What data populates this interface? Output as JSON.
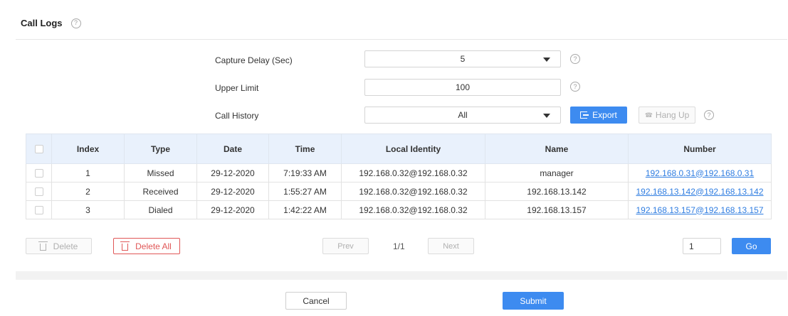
{
  "header": {
    "title": "Call Logs",
    "help_glyph": "?"
  },
  "form": {
    "capture_delay": {
      "label": "Capture Delay (Sec)",
      "value": "5"
    },
    "upper_limit": {
      "label": "Upper Limit",
      "value": "100"
    },
    "call_history": {
      "label": "Call History",
      "value": "All"
    }
  },
  "actions": {
    "export_label": "Export",
    "hangup_label": "Hang Up",
    "hangup_icon": "phone-icon"
  },
  "table": {
    "columns": [
      "Index",
      "Type",
      "Date",
      "Time",
      "Local Identity",
      "Name",
      "Number"
    ],
    "rows": [
      {
        "index": "1",
        "type": "Missed",
        "date": "29-12-2020",
        "time": "7:19:33 AM",
        "local_identity": "192.168.0.32@192.168.0.32",
        "name": "manager",
        "number": "192.168.0.31@192.168.0.31"
      },
      {
        "index": "2",
        "type": "Received",
        "date": "29-12-2020",
        "time": "1:55:27 AM",
        "local_identity": "192.168.0.32@192.168.0.32",
        "name": "192.168.13.142",
        "number": "192.168.13.142@192.168.13.142"
      },
      {
        "index": "3",
        "type": "Dialed",
        "date": "29-12-2020",
        "time": "1:42:22 AM",
        "local_identity": "192.168.0.32@192.168.0.32",
        "name": "192.168.13.157",
        "number": "192.168.13.157@192.168.13.157"
      }
    ]
  },
  "pagination": {
    "delete_label": "Delete",
    "delete_all_label": "Delete All",
    "prev_label": "Prev",
    "next_label": "Next",
    "page_indicator": "1/1",
    "page_input": "1",
    "go_label": "Go"
  },
  "footer": {
    "cancel_label": "Cancel",
    "submit_label": "Submit"
  },
  "colors": {
    "primary": "#3d8bf0",
    "danger": "#e05757",
    "table_header_bg": "#e9f1fc",
    "link": "#2f7de1"
  }
}
